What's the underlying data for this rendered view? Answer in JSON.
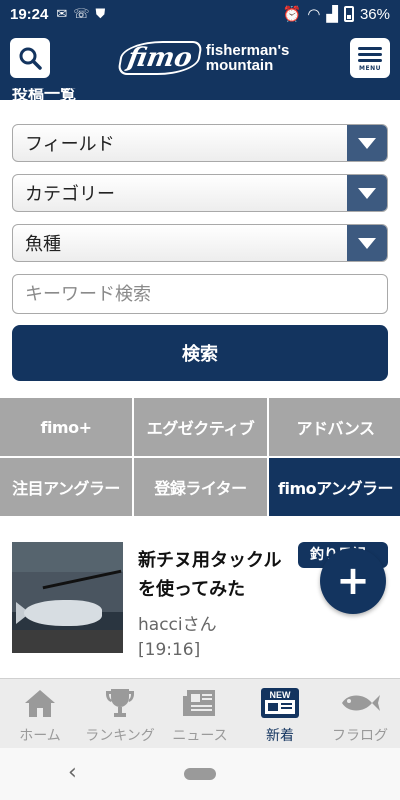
{
  "status_bar": {
    "time": "19:24",
    "battery": "36%"
  },
  "header": {
    "logo_main": "fimo",
    "logo_line1": "fisherman's",
    "logo_line2": "mountain",
    "menu_label": "MENU"
  },
  "partial_heading": "投稿一覧",
  "filters": {
    "field": "フィールド",
    "category": "カテゴリー",
    "species": "魚種",
    "keyword_placeholder": "キーワード検索",
    "search_button": "検索"
  },
  "categories": [
    {
      "label": "fimo+"
    },
    {
      "label": "エグゼクティブ"
    },
    {
      "label": "アドバンス"
    },
    {
      "label": "注目アングラー"
    },
    {
      "label": "登録ライター"
    },
    {
      "label": "fimoアングラー",
      "active": true
    }
  ],
  "article": {
    "title": "新チヌ用タックルを使ってみた",
    "author": "hacciさん",
    "time": "[19:16]",
    "badge": "釣り日記"
  },
  "fab": "+",
  "bottom_nav": [
    {
      "label": "ホーム",
      "icon": "home-icon"
    },
    {
      "label": "ランキング",
      "icon": "trophy-icon"
    },
    {
      "label": "ニュース",
      "icon": "newspaper-icon"
    },
    {
      "label": "新着",
      "icon": "new-badge-icon",
      "active": true
    },
    {
      "label": "フラログ",
      "icon": "fish-icon"
    }
  ],
  "colors": {
    "primary": "#13345f",
    "inactive_tab": "#a6a6a6"
  }
}
